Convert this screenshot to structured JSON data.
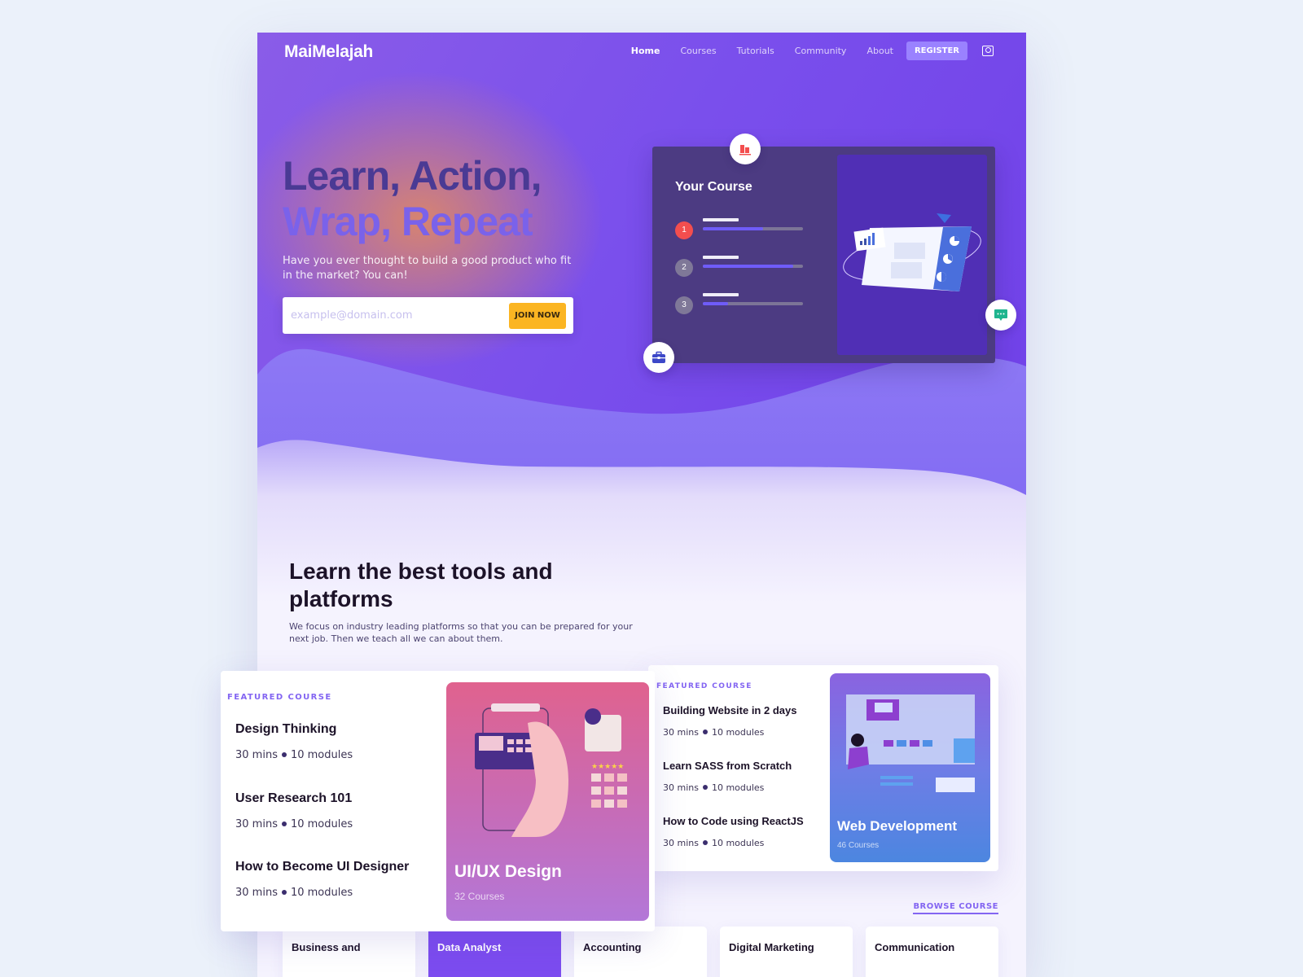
{
  "brand": {
    "logo": "MaiMelajah",
    "accent": "#7a4fec",
    "cta_color": "#fbb522"
  },
  "nav": {
    "items": [
      {
        "label": "Home",
        "active": true
      },
      {
        "label": "Courses",
        "active": false
      },
      {
        "label": "Tutorials",
        "active": false
      },
      {
        "label": "Community",
        "active": false
      },
      {
        "label": "About",
        "active": false
      }
    ],
    "register_label": "REGISTER",
    "user_icon": "user-profile-icon"
  },
  "hero": {
    "headline_line1": "Learn, Action,",
    "headline_line2": "Wrap, Repeat",
    "subtitle": "Have you ever thought to build a good product who fit in the market? You can!",
    "email_placeholder": "example@domain.com",
    "email_value": "",
    "join_label": "JOIN NOW"
  },
  "course_card": {
    "title": "Your Course",
    "items": [
      {
        "number": "1",
        "progress": 0.6,
        "active": true
      },
      {
        "number": "2",
        "progress": 0.9,
        "active": false
      },
      {
        "number": "3",
        "progress": 0.25,
        "active": false
      }
    ],
    "floating_icons": [
      "bar-chart-icon",
      "chat-icon",
      "briefcase-icon"
    ]
  },
  "section": {
    "title": "Learn the best tools and platforms",
    "description": "We focus on industry leading platforms so that you can be prepared for your next job. Then we teach all we can about them."
  },
  "featured_left": {
    "label": "FEATURED COURSE",
    "items": [
      {
        "title": "Design Thinking",
        "duration": "30 mins",
        "modules": "10 modules"
      },
      {
        "title": "User Research 101",
        "duration": "30 mins",
        "modules": "10 modules"
      },
      {
        "title": "How to Become UI Designer",
        "duration": "30 mins",
        "modules": "10 modules"
      }
    ],
    "category": {
      "name": "UI/UX Design",
      "count": "32 Courses"
    }
  },
  "featured_right": {
    "label": "FEATURED COURSE",
    "items": [
      {
        "title": "Building Website in 2 days",
        "duration": "30 mins",
        "modules": "10 modules"
      },
      {
        "title": "Learn SASS from Scratch",
        "duration": "30 mins",
        "modules": "10 modules"
      },
      {
        "title": "How to Code using ReactJS",
        "duration": "30 mins",
        "modules": "10 modules"
      }
    ],
    "category": {
      "name": "Web Development",
      "count": "46 Courses"
    }
  },
  "browse_label": "BROWSE COURSE",
  "categories": [
    {
      "label": "Business and",
      "active": false
    },
    {
      "label": "Data Analyst",
      "active": true
    },
    {
      "label": "Accounting",
      "active": false
    },
    {
      "label": "Digital Marketing",
      "active": false
    },
    {
      "label": "Communication",
      "active": false
    }
  ]
}
